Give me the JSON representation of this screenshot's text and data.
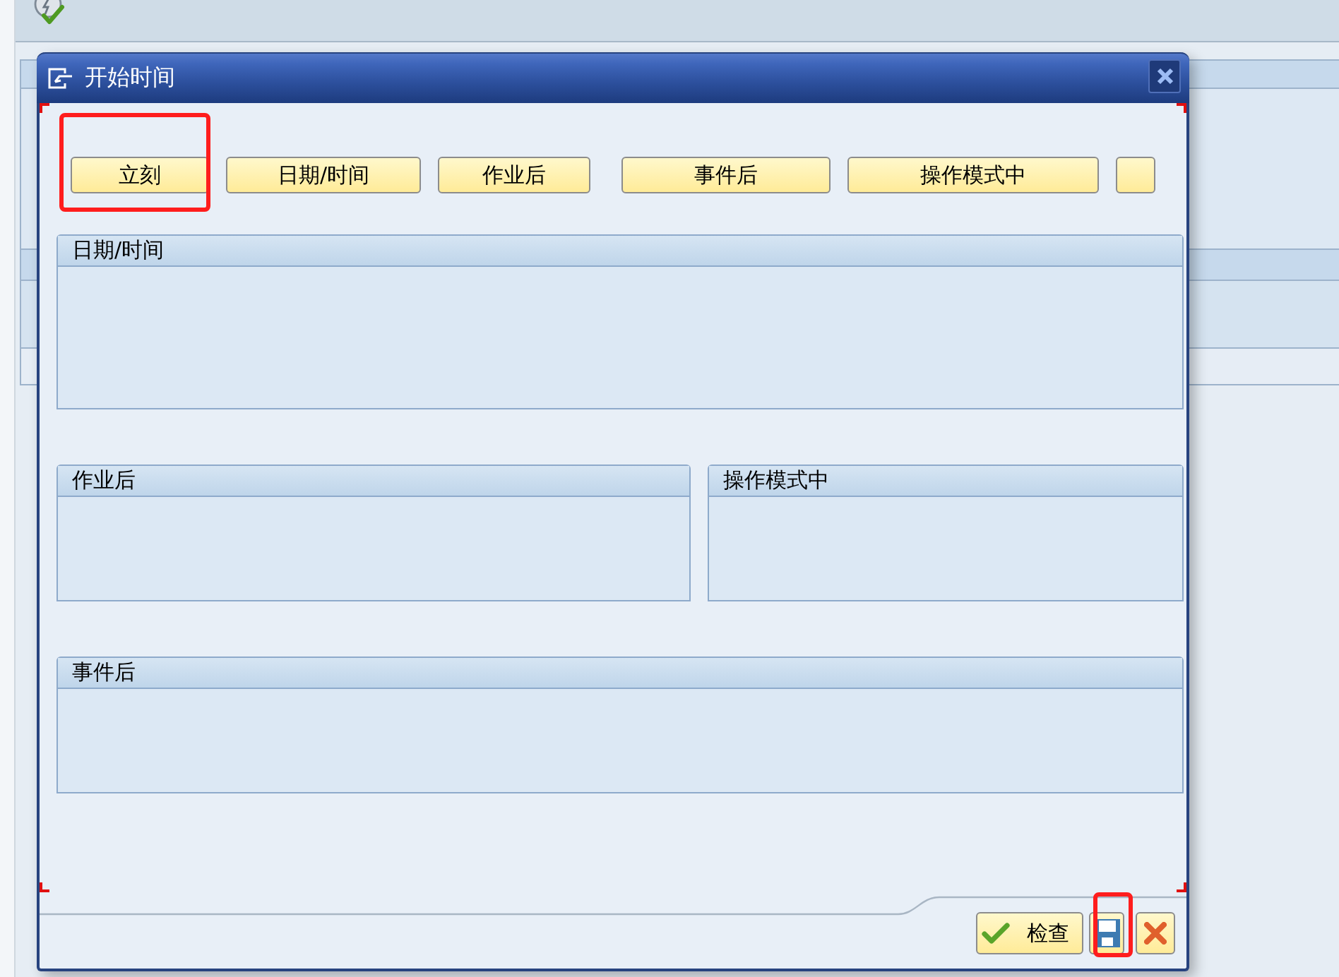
{
  "dialog": {
    "title": "开始时间"
  },
  "start_options": [
    {
      "kind": "text",
      "label": "立刻",
      "highlighted": true
    },
    {
      "kind": "text",
      "label": "日期/时间",
      "highlighted": false
    },
    {
      "kind": "text",
      "label": "作业后",
      "highlighted": false
    },
    {
      "kind": "text",
      "label": "事件后",
      "highlighted": false
    },
    {
      "kind": "text",
      "label": "操作模式中",
      "highlighted": false
    },
    {
      "kind": "blank",
      "highlighted": false
    }
  ],
  "group_rows": [
    {
      "groups": [
        {
          "title": "日期/时间"
        }
      ]
    },
    {
      "groups": [
        {
          "title": "作业后"
        },
        {
          "title": "操作模式中"
        }
      ]
    },
    {
      "groups": [
        {
          "title": "事件后"
        }
      ]
    }
  ],
  "footer_buttons": [
    {
      "kind": "check",
      "label": "检查",
      "highlighted": false
    },
    {
      "kind": "save",
      "highlighted": true
    },
    {
      "kind": "cancel",
      "highlighted": false
    }
  ]
}
